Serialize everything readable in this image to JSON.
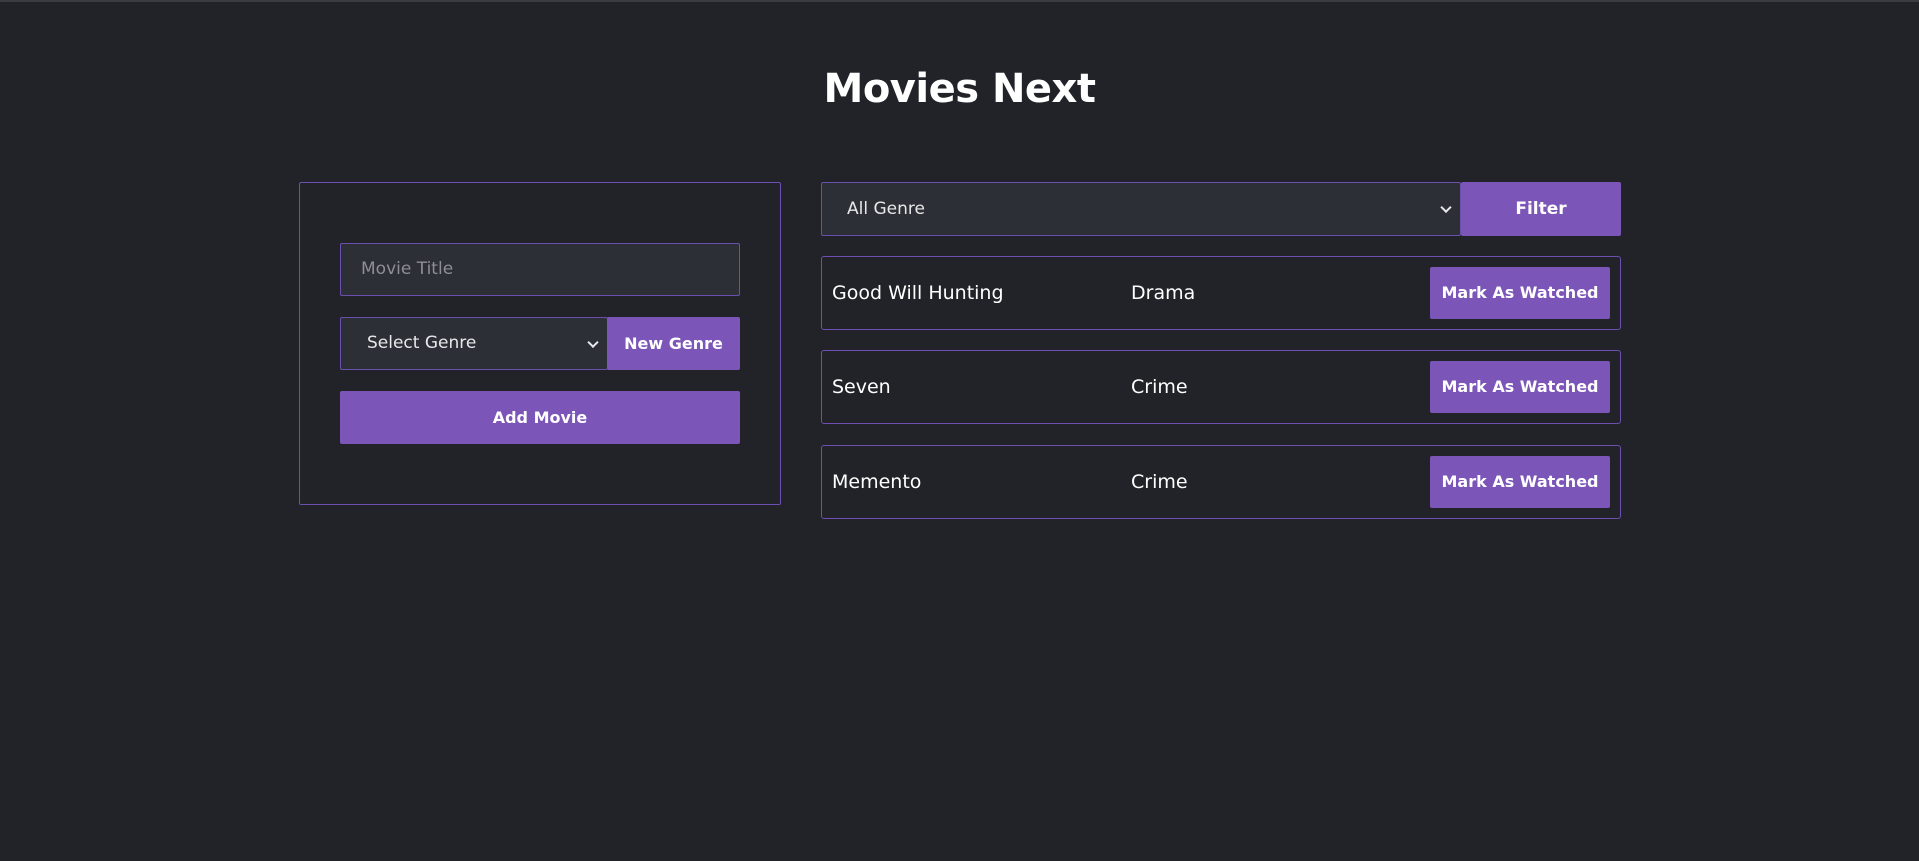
{
  "page": {
    "title": "Movies Next"
  },
  "add_form": {
    "title_placeholder": "Movie Title",
    "genre_select": "Select Genre",
    "new_genre_label": "New Genre",
    "add_movie_label": "Add Movie"
  },
  "filter": {
    "selected": "All Genre",
    "button_label": "Filter"
  },
  "movies": [
    {
      "title": "Good Will Hunting",
      "genre": "Drama",
      "action": "Mark As Watched"
    },
    {
      "title": "Seven",
      "genre": "Crime",
      "action": "Mark As Watched"
    },
    {
      "title": "Memento",
      "genre": "Crime",
      "action": "Mark As Watched"
    }
  ],
  "colors": {
    "background": "#212329",
    "accent": "#7b55b7",
    "border": "#6c4fb0"
  }
}
